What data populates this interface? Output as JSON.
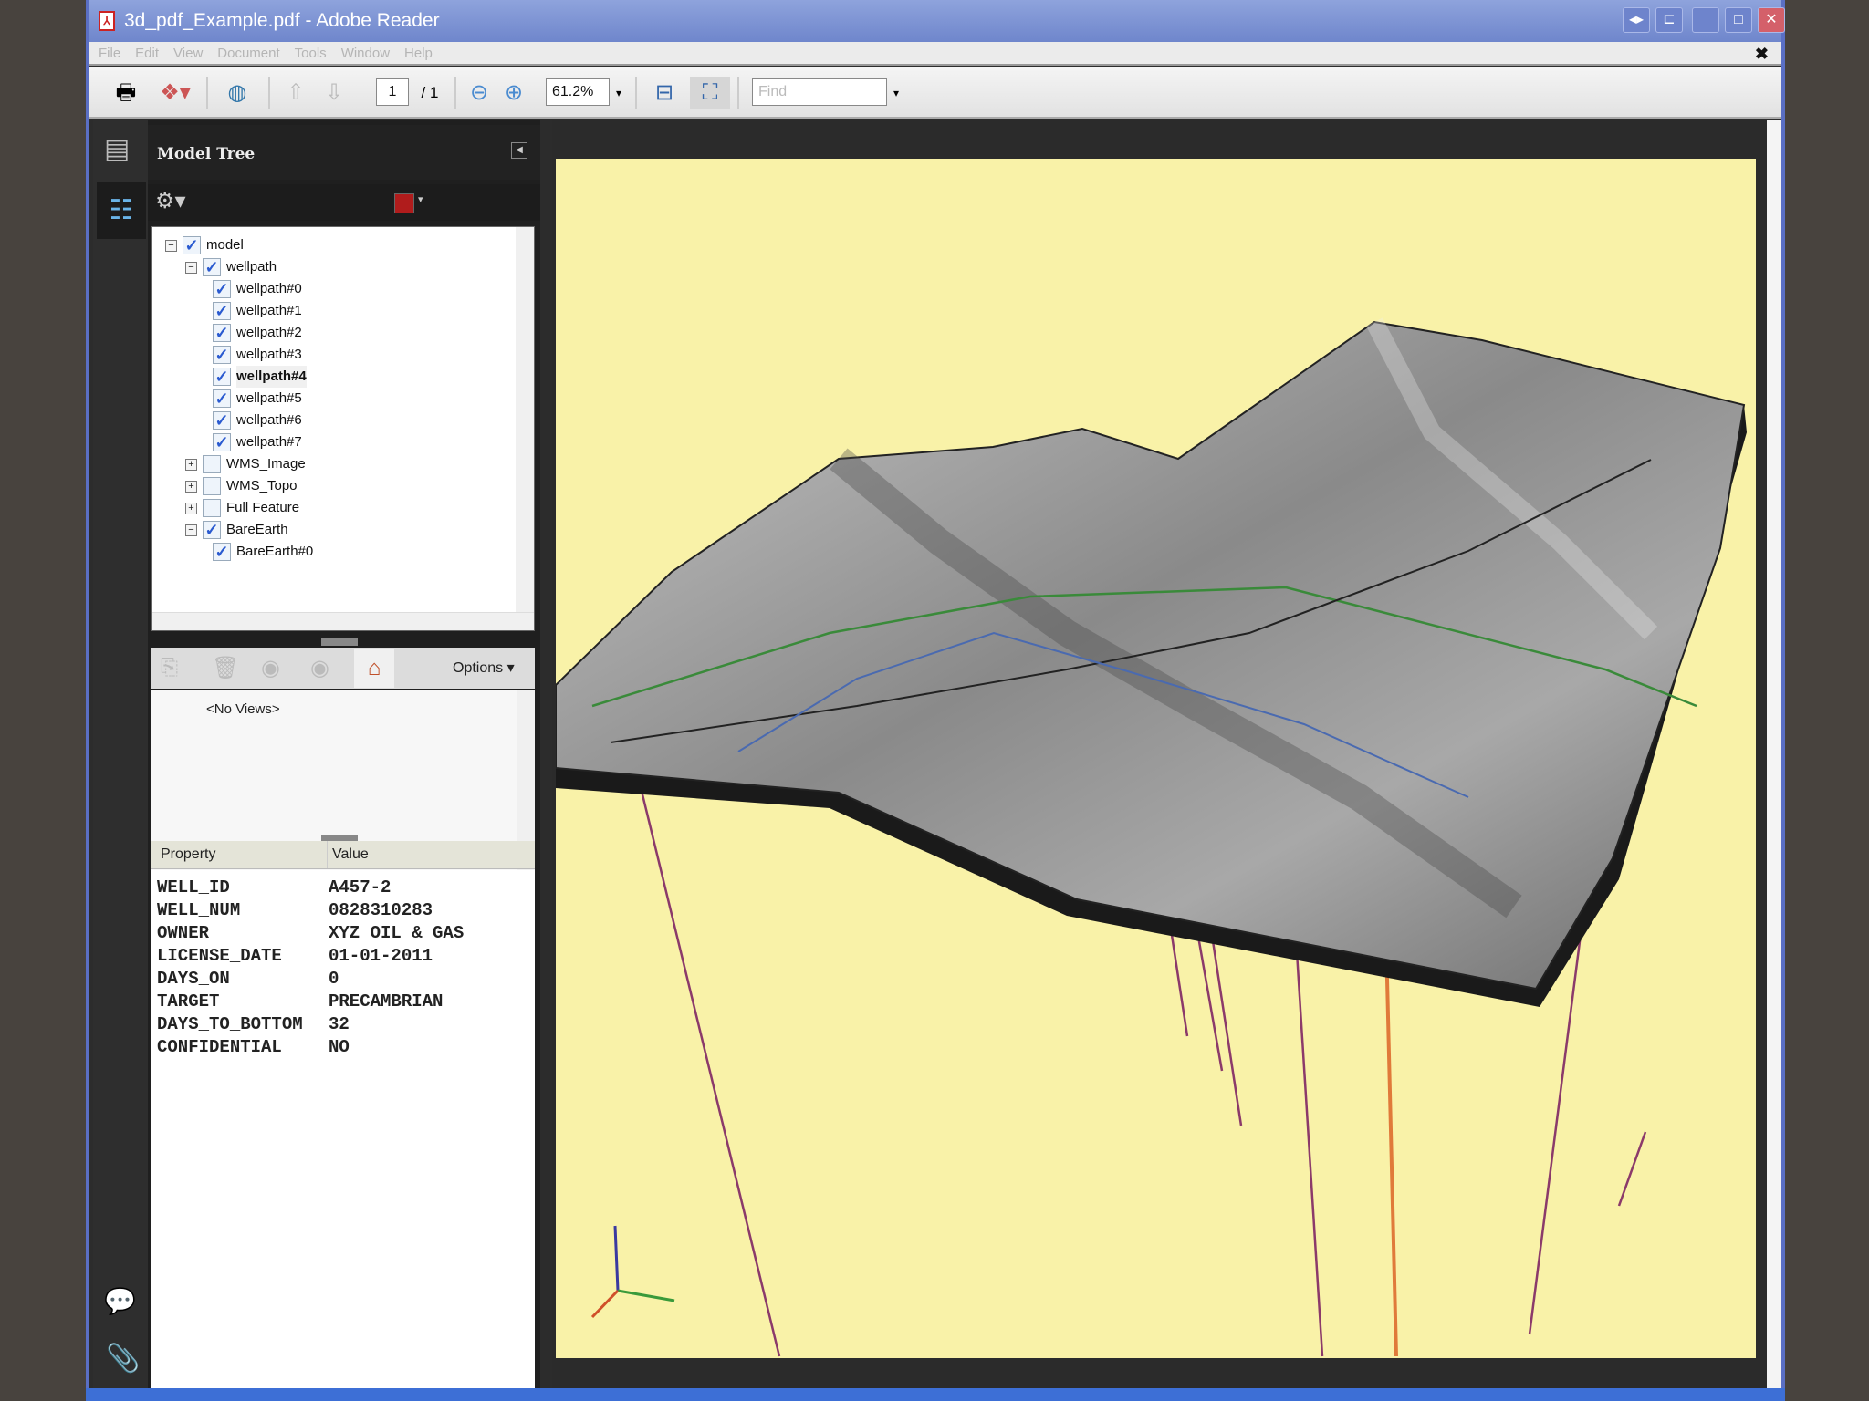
{
  "window": {
    "title": "3d_pdf_Example.pdf - Adobe Reader"
  },
  "menu": [
    "File",
    "Edit",
    "View",
    "Document",
    "Tools",
    "Window",
    "Help"
  ],
  "toolbar": {
    "page_current": "1",
    "page_total": "/ 1",
    "zoom": "61.2%",
    "find_placeholder": "Find"
  },
  "model_tree": {
    "title": "Model Tree",
    "color_swatch": "#b01c1c",
    "items": [
      {
        "label": "model",
        "level": 0,
        "expander": "−",
        "checked": true
      },
      {
        "label": "wellpath",
        "level": 1,
        "expander": "−",
        "checked": true
      },
      {
        "label": "wellpath#0",
        "level": 2,
        "checked": true
      },
      {
        "label": "wellpath#1",
        "level": 2,
        "checked": true
      },
      {
        "label": "wellpath#2",
        "level": 2,
        "checked": true
      },
      {
        "label": "wellpath#3",
        "level": 2,
        "checked": true
      },
      {
        "label": "wellpath#4",
        "level": 2,
        "checked": true,
        "selected": true
      },
      {
        "label": "wellpath#5",
        "level": 2,
        "checked": true
      },
      {
        "label": "wellpath#6",
        "level": 2,
        "checked": true
      },
      {
        "label": "wellpath#7",
        "level": 2,
        "checked": true
      },
      {
        "label": "WMS_Image",
        "level": 1,
        "expander": "+",
        "checked": false
      },
      {
        "label": "WMS_Topo",
        "level": 1,
        "expander": "+",
        "checked": false
      },
      {
        "label": "Full Feature",
        "level": 1,
        "expander": "+",
        "checked": false
      },
      {
        "label": "BareEarth",
        "level": 1,
        "expander": "−",
        "checked": true
      },
      {
        "label": "BareEarth#0",
        "level": 2,
        "checked": true
      }
    ]
  },
  "views": {
    "options_label": "Options",
    "empty_text": "<No Views>"
  },
  "properties": {
    "headers": [
      "Property",
      "Value"
    ],
    "rows": [
      [
        "WELL_ID",
        "A457-2"
      ],
      [
        "WELL_NUM",
        "0828310283"
      ],
      [
        "OWNER",
        "XYZ OIL & GAS"
      ],
      [
        "LICENSE_DATE",
        "01-01-2011"
      ],
      [
        "DAYS_ON",
        "0"
      ],
      [
        "TARGET",
        "PRECAMBRIAN"
      ],
      [
        "DAYS_TO_BOTTOM",
        "32"
      ],
      [
        "CONFIDENTIAL",
        "NO"
      ]
    ]
  },
  "colors": {
    "canvas_bg": "#f9f2a8",
    "wellpath": "#8b3a6a",
    "selected_well": "#e07a3a"
  }
}
